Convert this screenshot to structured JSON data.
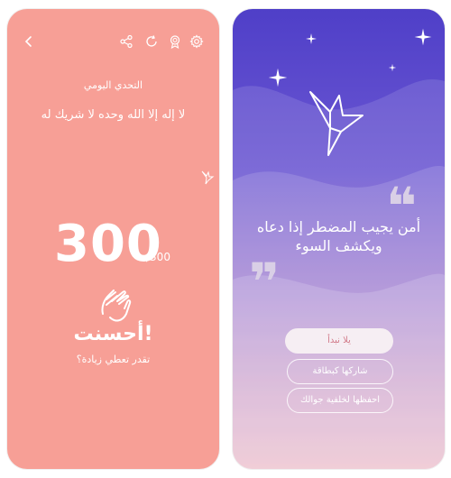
{
  "left": {
    "title": "التحدي اليومي",
    "dhikr": "لا إله إلا الله وحده لا شريك له",
    "score": "300",
    "total": "/300",
    "done": "أحسنت!",
    "prompt": "تقدر تعطي زيادة؟",
    "icons": [
      "back-icon",
      "share-icon",
      "refresh-icon",
      "badge-icon",
      "settings-icon"
    ],
    "colors": {
      "bg": "#f79f96"
    }
  },
  "right": {
    "verse_line1": "أمن يجيب المضطر إذا دعاه",
    "verse_line2": "ويكشف السوء",
    "buttons": {
      "start": "يلا نبدأ",
      "share": "شاركها كبطاقة",
      "save": "احفظها لخلفية جوالك"
    },
    "colors": {
      "top": "#4f3fc8",
      "bottom": "#e8b3c2"
    }
  }
}
